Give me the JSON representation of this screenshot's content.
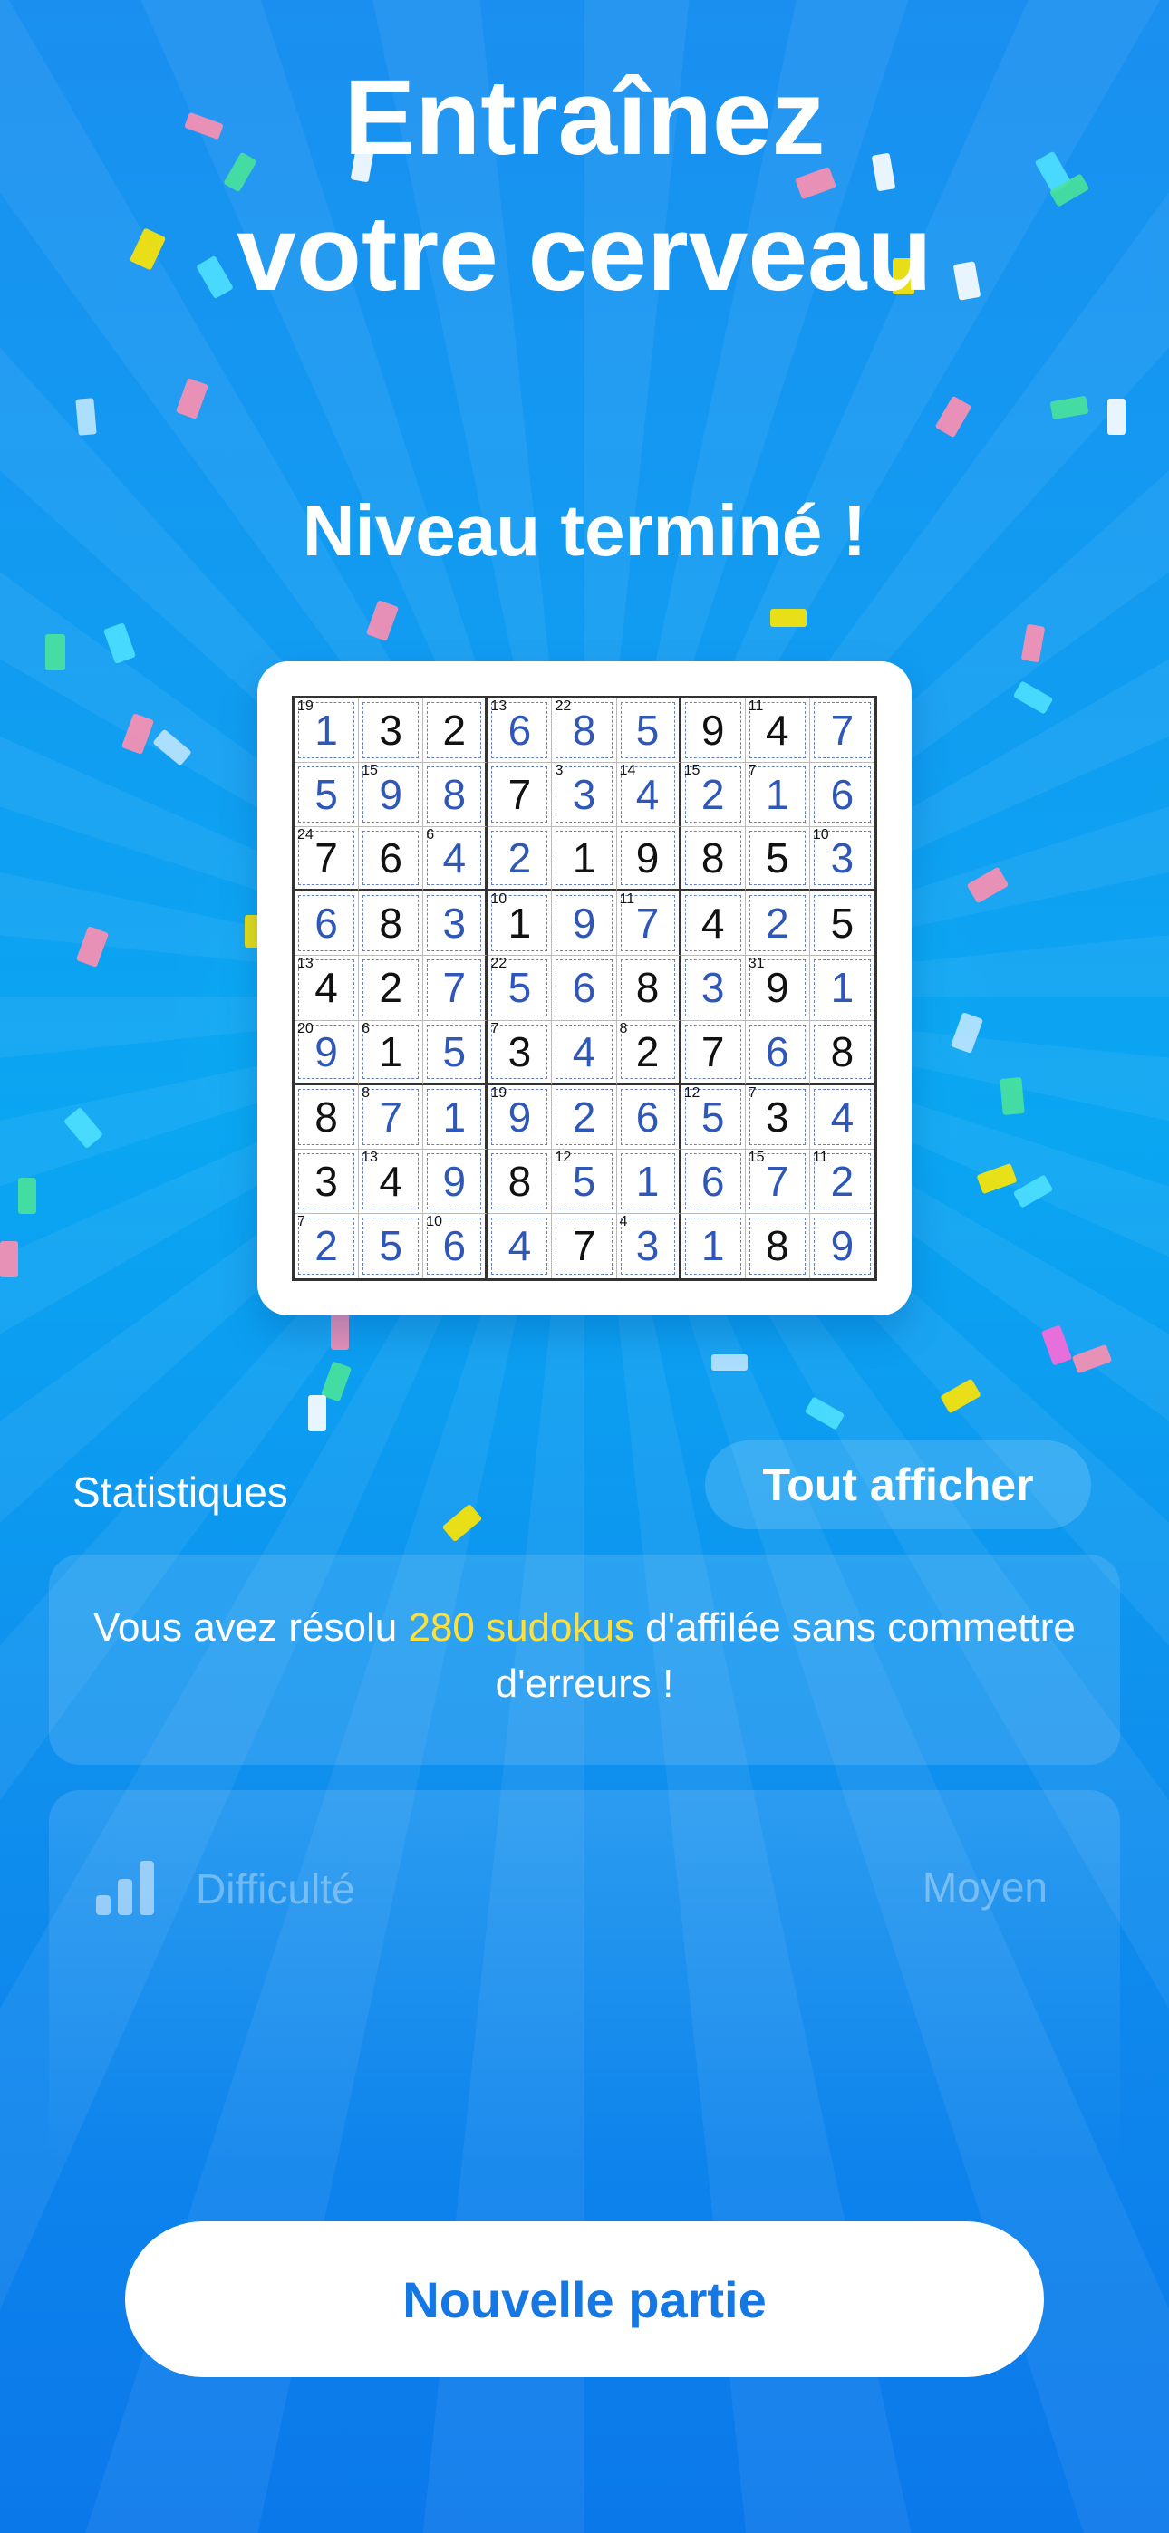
{
  "header": {
    "title_line1": "Entraînez",
    "title_line2": "votre cerveau"
  },
  "level": {
    "done": "Niveau terminé !"
  },
  "board": {
    "rows": [
      [
        "1",
        "3",
        "2",
        "6",
        "8",
        "5",
        "9",
        "4",
        "7"
      ],
      [
        "5",
        "9",
        "8",
        "7",
        "3",
        "4",
        "2",
        "1",
        "6"
      ],
      [
        "7",
        "6",
        "4",
        "2",
        "1",
        "9",
        "8",
        "5",
        "3"
      ],
      [
        "6",
        "8",
        "3",
        "1",
        "9",
        "7",
        "4",
        "2",
        "5"
      ],
      [
        "4",
        "2",
        "7",
        "5",
        "6",
        "8",
        "3",
        "9",
        "1"
      ],
      [
        "9",
        "1",
        "5",
        "3",
        "4",
        "2",
        "7",
        "6",
        "8"
      ],
      [
        "8",
        "7",
        "1",
        "9",
        "2",
        "6",
        "5",
        "3",
        "4"
      ],
      [
        "3",
        "4",
        "9",
        "8",
        "5",
        "1",
        "6",
        "7",
        "2"
      ],
      [
        "2",
        "5",
        "6",
        "4",
        "7",
        "3",
        "1",
        "8",
        "9"
      ]
    ],
    "user_entered": [
      [
        1,
        0,
        0,
        1,
        1,
        1,
        0,
        0,
        1
      ],
      [
        1,
        1,
        1,
        0,
        1,
        1,
        1,
        1,
        1
      ],
      [
        0,
        0,
        1,
        1,
        0,
        0,
        0,
        0,
        1
      ],
      [
        1,
        0,
        1,
        0,
        1,
        1,
        0,
        1,
        0
      ],
      [
        0,
        0,
        1,
        1,
        1,
        0,
        1,
        0,
        1
      ],
      [
        1,
        0,
        1,
        0,
        1,
        0,
        0,
        1,
        0
      ],
      [
        0,
        1,
        1,
        1,
        1,
        1,
        1,
        0,
        1
      ],
      [
        0,
        0,
        1,
        0,
        1,
        1,
        1,
        1,
        1
      ],
      [
        1,
        1,
        1,
        1,
        0,
        1,
        1,
        0,
        1
      ]
    ],
    "cage_sums": [
      [
        "19",
        "",
        "",
        "13",
        "22",
        "",
        "",
        "11",
        ""
      ],
      [
        "",
        "15",
        "",
        "",
        "3",
        "14",
        "15",
        "7",
        ""
      ],
      [
        "24",
        "",
        "6",
        "",
        "",
        "",
        "",
        "",
        "10"
      ],
      [
        "",
        "",
        "",
        "10",
        "",
        "11",
        "",
        "",
        ""
      ],
      [
        "13",
        "",
        "",
        "22",
        "",
        "",
        "",
        "31",
        ""
      ],
      [
        "20",
        "6",
        "",
        "7",
        "",
        "8",
        "",
        "",
        ""
      ],
      [
        "",
        "8",
        "",
        "19",
        "",
        "",
        "12",
        "7",
        ""
      ],
      [
        "",
        "13",
        "",
        "",
        "12",
        "",
        "",
        "15",
        "11"
      ],
      [
        "7",
        "",
        "10",
        "",
        "",
        "4",
        "",
        "",
        ""
      ]
    ]
  },
  "stats": {
    "label": "Statistiques",
    "show_all": "Tout afficher",
    "streak_prefix": "Vous avez résolu ",
    "streak_highlight": "280 sudokus",
    "streak_suffix": " d'affilée sans commettre d'erreurs !",
    "highlight_color": "#ffe03a"
  },
  "difficulty": {
    "icon": "signal-bars-icon",
    "label": "Difficulté",
    "value": "Moyen"
  },
  "actions": {
    "new_game": "Nouvelle partie"
  }
}
